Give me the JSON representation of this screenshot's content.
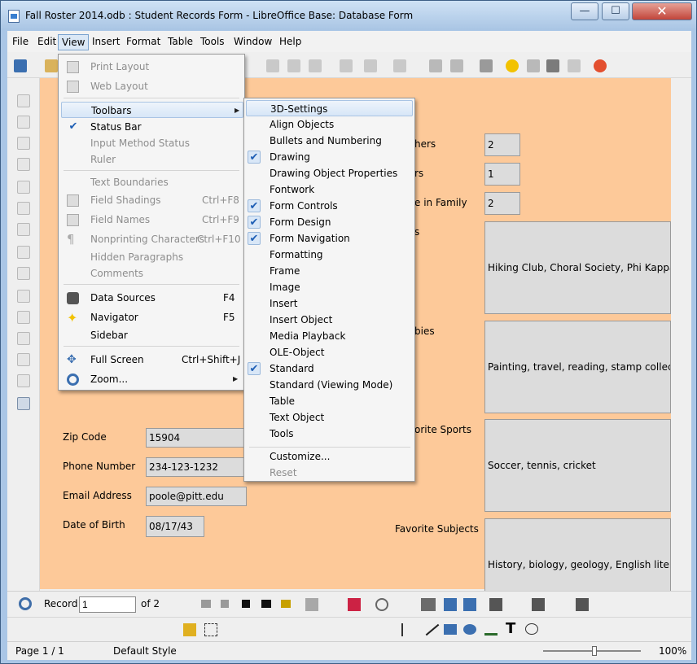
{
  "window": {
    "title": "Fall Roster 2014.odb : Student Records Form - LibreOffice Base: Database Form",
    "min_label": "—",
    "max_label": "☐",
    "close_label": "✕"
  },
  "menubar": [
    "File",
    "Edit",
    "View",
    "Insert",
    "Format",
    "Table",
    "Tools",
    "Window",
    "Help"
  ],
  "view_menu": {
    "print_layout": "Print Layout",
    "web_layout": "Web Layout",
    "toolbars": "Toolbars",
    "status_bar": "Status Bar",
    "input_method_status": "Input Method Status",
    "ruler": "Ruler",
    "text_boundaries": "Text Boundaries",
    "field_shadings": "Field Shadings",
    "field_shadings_shortcut": "Ctrl+F8",
    "field_names": "Field Names",
    "field_names_shortcut": "Ctrl+F9",
    "nonprinting": "Nonprinting Characters",
    "nonprinting_shortcut": "Ctrl+F10",
    "hidden_paragraphs": "Hidden Paragraphs",
    "comments": "Comments",
    "data_sources": "Data Sources",
    "data_sources_shortcut": "F4",
    "navigator": "Navigator",
    "navigator_shortcut": "F5",
    "sidebar": "Sidebar",
    "full_screen": "Full Screen",
    "full_screen_shortcut": "Ctrl+Shift+J",
    "zoom": "Zoom..."
  },
  "toolbars_submenu": {
    "items": [
      {
        "label": "3D-Settings",
        "checked": false
      },
      {
        "label": "Align Objects",
        "checked": false
      },
      {
        "label": "Bullets and Numbering",
        "checked": false
      },
      {
        "label": "Drawing",
        "checked": true
      },
      {
        "label": "Drawing Object Properties",
        "checked": false
      },
      {
        "label": "Fontwork",
        "checked": false
      },
      {
        "label": "Form Controls",
        "checked": true
      },
      {
        "label": "Form Design",
        "checked": true
      },
      {
        "label": "Form Navigation",
        "checked": true
      },
      {
        "label": "Formatting",
        "checked": false
      },
      {
        "label": "Frame",
        "checked": false
      },
      {
        "label": "Image",
        "checked": false
      },
      {
        "label": "Insert",
        "checked": false
      },
      {
        "label": "Insert Object",
        "checked": false
      },
      {
        "label": "Media Playback",
        "checked": false
      },
      {
        "label": "OLE-Object",
        "checked": false
      },
      {
        "label": "Standard",
        "checked": true
      },
      {
        "label": "Standard (Viewing Mode)",
        "checked": false
      },
      {
        "label": "Table",
        "checked": false
      },
      {
        "label": "Text Object",
        "checked": false
      },
      {
        "label": "Tools",
        "checked": false
      }
    ],
    "customize": "Customize...",
    "reset": "Reset"
  },
  "form": {
    "zip_label": "Zip Code",
    "zip_value": "15904",
    "phone_label": "Phone Number",
    "phone_value": "234-123-1232",
    "email_label": "Email Address",
    "email_value": "poole@pitt.edu",
    "dob_label": "Date of Birth",
    "dob_value": "08/17/43",
    "right_label_1": "hers",
    "right_value_1": "2",
    "right_label_2": "rs",
    "right_value_2": "1",
    "right_label_3": "e in Family",
    "right_value_3": "2",
    "right_label_4": "s",
    "right_value_4": "Hiking Club, Choral Society, Phi Kappa Phi",
    "right_label_5": "bies",
    "right_value_5": "Painting, travel, reading, stamp collecting",
    "right_label_6": "orite Sports",
    "right_value_6": "Soccer, tennis, cricket",
    "right_label_7": "Favorite Subjects",
    "right_value_7": "History, biology, geology, English literature"
  },
  "navbar": {
    "record_label": "Record",
    "record_value": "1",
    "of_label": "of  2"
  },
  "statusbar": {
    "page": "Page 1 / 1",
    "style": "Default Style",
    "zoom": "100%"
  },
  "colors": {
    "form_background": "#fdc999",
    "check_color": "#1f5fb5",
    "highlight": "#d7e6f7"
  }
}
